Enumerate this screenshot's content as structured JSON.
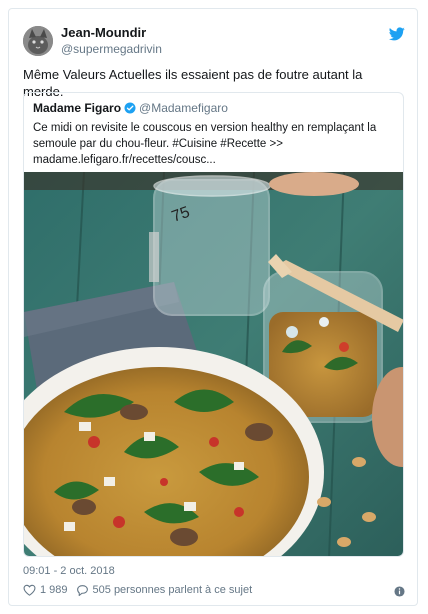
{
  "tweet": {
    "author_name": "Jean-Moundir",
    "author_handle": "@supermegadrivin",
    "text": "Même Valeurs Actuelles ils essaient pas de foutre autant la merde.",
    "timestamp": "09:01 - 2 oct. 2018",
    "likes": "1 989",
    "replies_text": "505 personnes parlent à ce sujet"
  },
  "quoted": {
    "author_name": "Madame Figaro",
    "author_handle": "@Madamefigaro",
    "text_line1": "Ce midi on revisite le couscous en version healthy en remplaçant la",
    "text_line2": "semoule par du chou-fleur. #Cuisine #Recette >>",
    "text_line3": "madame.lefigaro.fr/recettes/cousc..."
  },
  "colors": {
    "twitter_blue": "#1da1f2",
    "verified_blue": "#1da1f2",
    "muted": "#657786"
  },
  "icons": {
    "brand": "twitter-bird-icon",
    "like": "heart-icon",
    "reply": "speech-bubble-icon",
    "info": "info-icon"
  }
}
